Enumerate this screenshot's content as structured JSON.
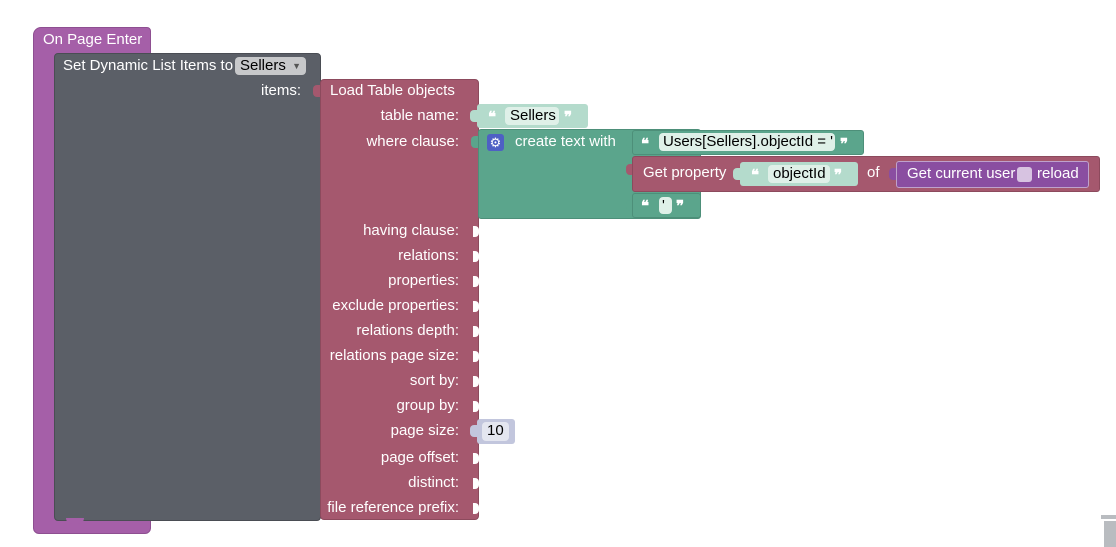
{
  "event": {
    "label": "On Page Enter"
  },
  "set_block": {
    "label": "Set Dynamic List Items to",
    "dropdown_value": "Sellers",
    "items_label": "items:"
  },
  "load_block": {
    "title": "Load Table objects",
    "params": [
      "table name:",
      "where clause:",
      "having clause:",
      "relations:",
      "properties:",
      "exclude properties:",
      "relations depth:",
      "relations page size:",
      "sort by:",
      "group by:",
      "page size:",
      "page offset:",
      "distinct:",
      "file reference prefix:"
    ]
  },
  "table_name_text": {
    "value": "Sellers"
  },
  "create_text": {
    "label": "create text with"
  },
  "where_text_1": {
    "value": "Users[Sellers].objectId = '"
  },
  "get_property": {
    "label": "Get property",
    "property": "objectId",
    "of_label": "of"
  },
  "current_user": {
    "label": "Get current user",
    "reload_label": "reload"
  },
  "where_text_3": {
    "value": "'"
  },
  "page_size": {
    "value": "10"
  },
  "colors": {
    "event": "#a55fa8",
    "set_block": "#5b5f67",
    "load_block": "#a5586e",
    "text_block": "#5ba58c",
    "text_light": "#b4dbcc",
    "current_user": "#8a4ea1",
    "number": "#c2c6dd"
  }
}
